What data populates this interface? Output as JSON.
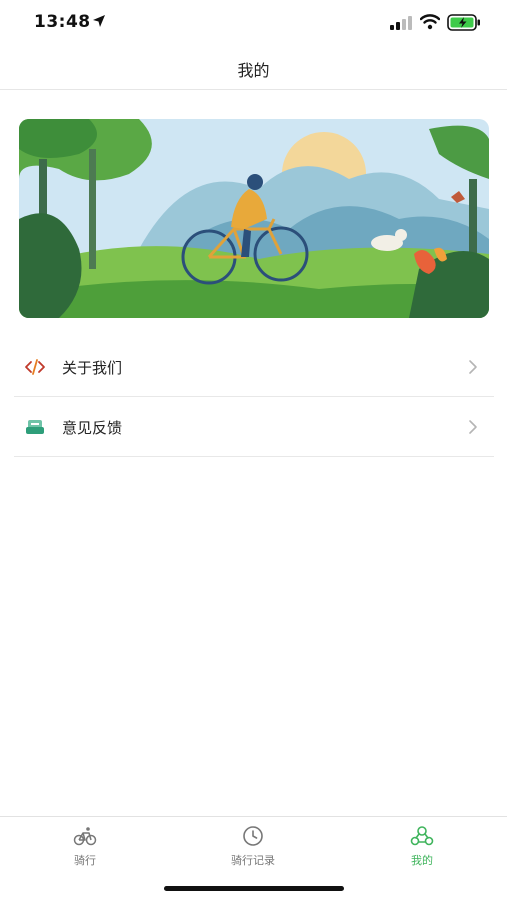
{
  "status_bar": {
    "time": "13:48"
  },
  "nav": {
    "title": "我的"
  },
  "menu": {
    "items": [
      {
        "label": "关于我们",
        "icon": "code-icon"
      },
      {
        "label": "意见反馈",
        "icon": "feedback-icon"
      }
    ]
  },
  "tabs": [
    {
      "label": "骑行",
      "icon": "bicycle-icon",
      "active": false
    },
    {
      "label": "骑行记录",
      "icon": "clock-icon",
      "active": false
    },
    {
      "label": "我的",
      "icon": "profile-icon",
      "active": true
    }
  ],
  "colors": {
    "accent": "#3fb45c",
    "code_icon": "#c0392b",
    "feedback_icon": "#2e9e7a"
  }
}
